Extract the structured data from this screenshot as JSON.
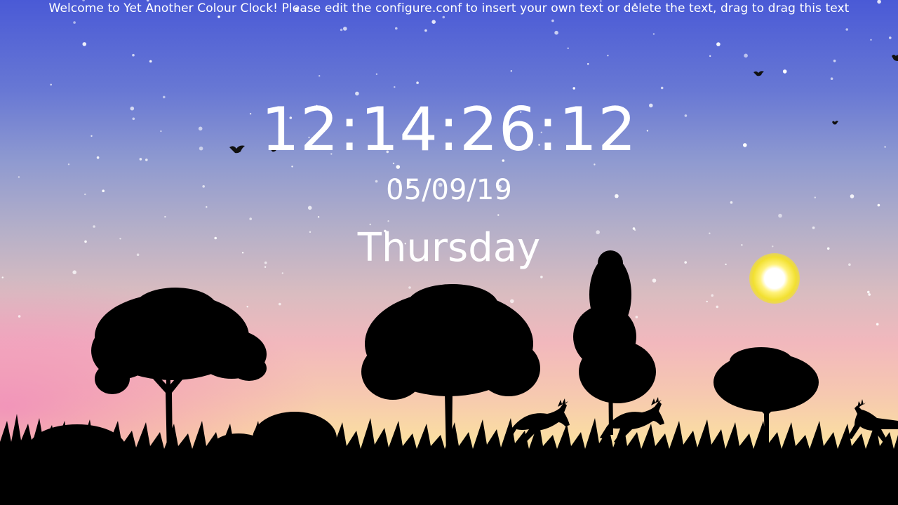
{
  "banner": {
    "text": "Welcome to Yet Another Colour Clock! Please edit the configure.conf to insert your own text or delete the text, drag to drag this text"
  },
  "clock": {
    "time": "12:14:26:12",
    "date": "05/09/19",
    "day": "Thursday"
  },
  "scene": {
    "icons": [
      "sun-icon",
      "bird-icon",
      "tree-icon",
      "deer-icon",
      "grass-icon",
      "star-icon"
    ]
  },
  "colors": {
    "sky_top": "#4a5ad6",
    "sky_bottom": "#fde89a",
    "text": "#ffffff",
    "sun": "#f2e030",
    "silhouette": "#000000"
  }
}
